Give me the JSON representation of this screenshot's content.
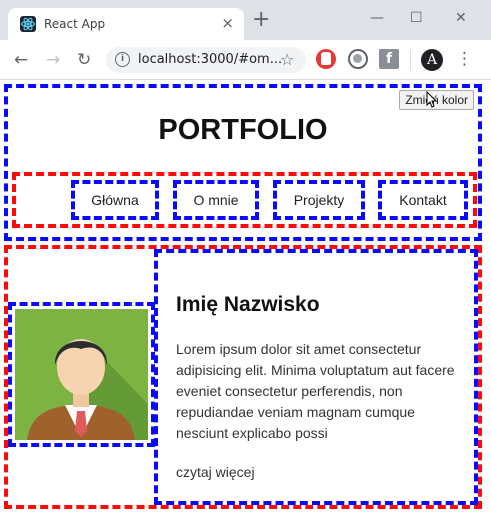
{
  "browser": {
    "tab_title": "React App",
    "tab_close": "×",
    "new_tab": "+",
    "url": "localhost:3000/#om...",
    "window_controls": {
      "minimize": "—",
      "maximize": "☐",
      "close": "✕"
    },
    "nav": {
      "back": "←",
      "forward": "→",
      "reload": "↻"
    },
    "info_icon": "i",
    "bookmark_icon": "☆",
    "extension_3": "f",
    "profile_initial": "A",
    "menu": "⋮"
  },
  "page": {
    "theme_button": "Zmień kolor",
    "title": "PORTFOLIO",
    "nav_items": [
      "Główna",
      "O mnie",
      "Projekty",
      "Kontakt"
    ],
    "profile": {
      "name": "Imię Nazwisko",
      "bio": "Lorem ipsum dolor sit amet consectetur adipisicing elit. Minima voluptatum aut facere eveniet consectetur perferendis, non repudiandae veniam magnam cumque nesciunt explicabo possi",
      "read_more": "czytaj więcej"
    }
  },
  "colors": {
    "frame_blue": "#0a0aff",
    "frame_red": "#ff0a0a",
    "photo_bg": "#7cb342",
    "jacket": "#a0622d",
    "tie": "#e05a5a"
  },
  "icons": [
    "react-favicon",
    "info-icon",
    "star-icon",
    "adblock-icon",
    "sync-icon",
    "extension-icon",
    "profile-icon",
    "menu-icon",
    "cursor-icon"
  ]
}
